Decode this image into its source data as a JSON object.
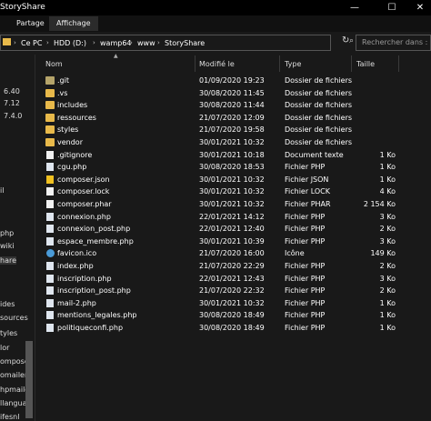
{
  "window": {
    "title": "StoryShare",
    "min_glyph": "—",
    "max_glyph": "☐",
    "close_glyph": "✕"
  },
  "ribbon": {
    "tabs": [
      "Partage",
      "Affichage"
    ]
  },
  "address": {
    "crumbs": [
      "Ce PC",
      "HDD (D:)",
      "wamp64",
      "www",
      "StoryShare"
    ],
    "sep_glyph": "›"
  },
  "search": {
    "placeholder": "Rechercher dans :"
  },
  "nav": {
    "items": [
      "6.40",
      "7.12",
      "7.4.0",
      "il",
      "php",
      "wiki",
      "hare",
      "ides",
      "sources",
      "tyles",
      "lor",
      "omposer",
      "omailer",
      "hpmaile",
      "llanguag",
      "ifesnl"
    ]
  },
  "columns": {
    "name": "Nom",
    "modified": "Modifié le",
    "type": "Type",
    "size": "Taille"
  },
  "files": [
    {
      "name": ".git",
      "date": "01/09/2020 19:23",
      "type": "Dossier de fichiers",
      "size": "",
      "icon": "folder-git-icon"
    },
    {
      "name": ".vs",
      "date": "30/08/2020 11:45",
      "type": "Dossier de fichiers",
      "size": "",
      "icon": "folder-icon"
    },
    {
      "name": "includes",
      "date": "30/08/2020 11:44",
      "type": "Dossier de fichiers",
      "size": "",
      "icon": "folder-icon"
    },
    {
      "name": "ressources",
      "date": "21/07/2020 12:09",
      "type": "Dossier de fichiers",
      "size": "",
      "icon": "folder-icon"
    },
    {
      "name": "styles",
      "date": "21/07/2020 19:58",
      "type": "Dossier de fichiers",
      "size": "",
      "icon": "folder-icon"
    },
    {
      "name": "vendor",
      "date": "30/01/2021 10:32",
      "type": "Dossier de fichiers",
      "size": "",
      "icon": "folder-icon"
    },
    {
      "name": ".gitignore",
      "date": "30/01/2021 10:18",
      "type": "Document texte",
      "size": "1 Ko",
      "icon": "text-file-icon"
    },
    {
      "name": "cgu.php",
      "date": "30/08/2020 18:53",
      "type": "Fichier PHP",
      "size": "1 Ko",
      "icon": "php-file-icon"
    },
    {
      "name": "composer.json",
      "date": "30/01/2021 10:32",
      "type": "Fichier JSON",
      "size": "1 Ko",
      "icon": "json-file-icon"
    },
    {
      "name": "composer.lock",
      "date": "30/01/2021 10:32",
      "type": "Fichier LOCK",
      "size": "4 Ko",
      "icon": "file-icon"
    },
    {
      "name": "composer.phar",
      "date": "30/01/2021 10:32",
      "type": "Fichier PHAR",
      "size": "2 154 Ko",
      "icon": "file-icon"
    },
    {
      "name": "connexion.php",
      "date": "22/01/2021 14:12",
      "type": "Fichier PHP",
      "size": "3 Ko",
      "icon": "php-file-icon"
    },
    {
      "name": "connexion_post.php",
      "date": "22/01/2021 12:40",
      "type": "Fichier PHP",
      "size": "2 Ko",
      "icon": "php-file-icon"
    },
    {
      "name": "espace_membre.php",
      "date": "30/01/2021 10:39",
      "type": "Fichier PHP",
      "size": "3 Ko",
      "icon": "php-file-icon"
    },
    {
      "name": "favicon.ico",
      "date": "21/07/2020 16:00",
      "type": "Icône",
      "size": "149 Ko",
      "icon": "ico-file-icon"
    },
    {
      "name": "index.php",
      "date": "21/07/2020 22:29",
      "type": "Fichier PHP",
      "size": "2 Ko",
      "icon": "php-file-icon"
    },
    {
      "name": "inscription.php",
      "date": "22/01/2021 12:43",
      "type": "Fichier PHP",
      "size": "3 Ko",
      "icon": "php-file-icon"
    },
    {
      "name": "inscription_post.php",
      "date": "21/07/2020 22:32",
      "type": "Fichier PHP",
      "size": "2 Ko",
      "icon": "php-file-icon"
    },
    {
      "name": "mail-2.php",
      "date": "30/01/2021 10:32",
      "type": "Fichier PHP",
      "size": "1 Ko",
      "icon": "php-file-icon"
    },
    {
      "name": "mentions_legales.php",
      "date": "30/08/2020 18:49",
      "type": "Fichier PHP",
      "size": "1 Ko",
      "icon": "php-file-icon"
    },
    {
      "name": "politiqueconfi.php",
      "date": "30/08/2020 18:49",
      "type": "Fichier PHP",
      "size": "1 Ko",
      "icon": "php-file-icon"
    }
  ]
}
